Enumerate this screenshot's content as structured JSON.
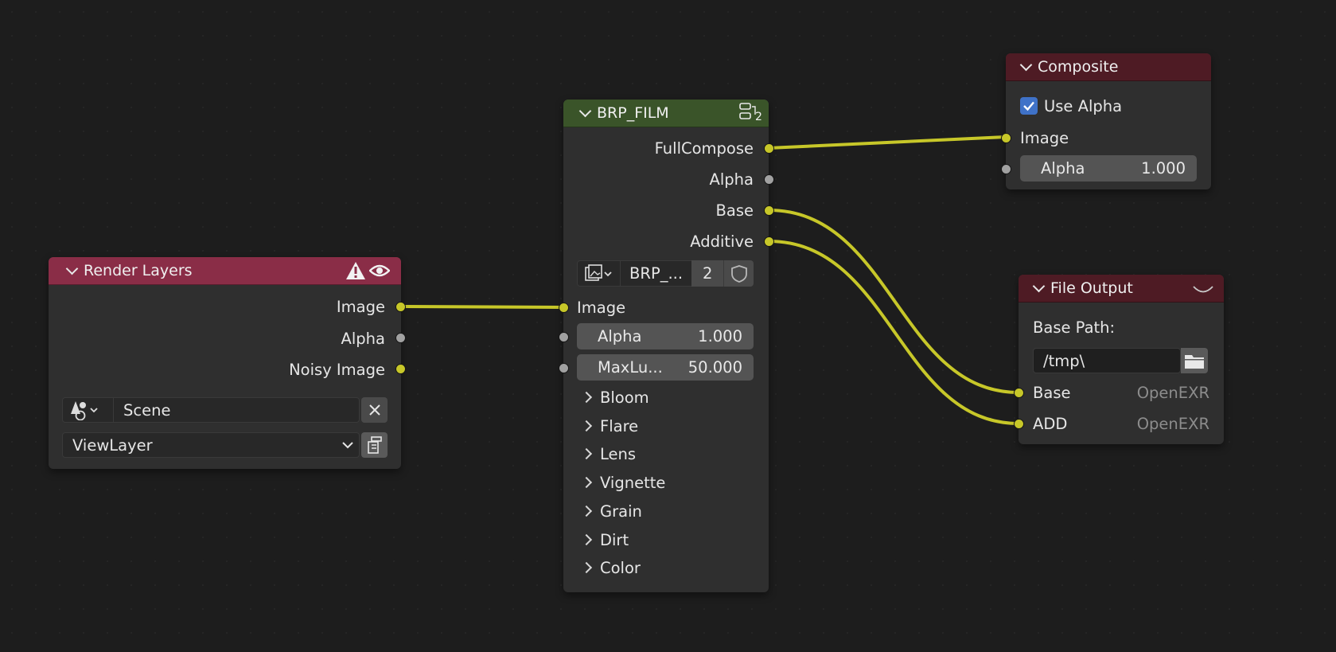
{
  "colors": {
    "background": "#1d1d1d",
    "node_body": "#2f2f2f",
    "render_layers_header": "#8a2d47",
    "group_header": "#3a5429",
    "output_header": "#4e1b24",
    "wire": "#c7c729",
    "checkbox": "#3f72c8"
  },
  "render_layers": {
    "title": "Render Layers",
    "warning_icon": "warning-icon",
    "eye_icon": "eye-icon",
    "outputs": [
      "Image",
      "Alpha",
      "Noisy Image"
    ],
    "scene_value": "Scene",
    "view_layer_value": "ViewLayer"
  },
  "brp_film": {
    "title": "BRP_FILM",
    "user_count": "2",
    "outputs": [
      "FullCompose",
      "Alpha",
      "Base",
      "Additive"
    ],
    "datablock_name": "BRP_...",
    "datablock_users": "2",
    "input_image": "Image",
    "alpha_label": "Alpha",
    "alpha_value": "1.000",
    "maxlu_label": "MaxLu...",
    "maxlu_value": "50.000",
    "panels": [
      "Bloom",
      "Flare",
      "Lens",
      "Vignette",
      "Grain",
      "Dirt",
      "Color"
    ]
  },
  "composite": {
    "title": "Composite",
    "use_alpha_label": "Use Alpha",
    "use_alpha_checked": true,
    "input_image": "Image",
    "alpha_label": "Alpha",
    "alpha_value": "1.000"
  },
  "file_output": {
    "title": "File Output",
    "base_path_label": "Base Path:",
    "base_path_value": "/tmp\\",
    "inputs": [
      {
        "label": "Base",
        "format": "OpenEXR"
      },
      {
        "label": "ADD",
        "format": "OpenEXR"
      }
    ]
  }
}
